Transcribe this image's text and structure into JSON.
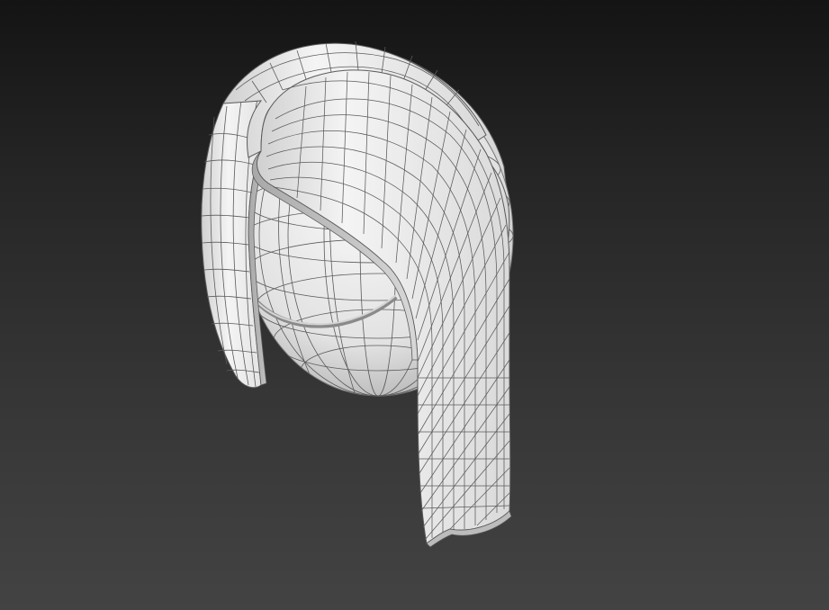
{
  "viewport": {
    "view": "perspective",
    "shading": "default-shading-with-edged-faces",
    "background_top": "#141414",
    "background_bottom": "#434343"
  },
  "scene": {
    "objects": [
      "head-sphere",
      "hair-shell"
    ],
    "material_color": "#f0f0f0",
    "wire_color": "#4a4a4a"
  }
}
